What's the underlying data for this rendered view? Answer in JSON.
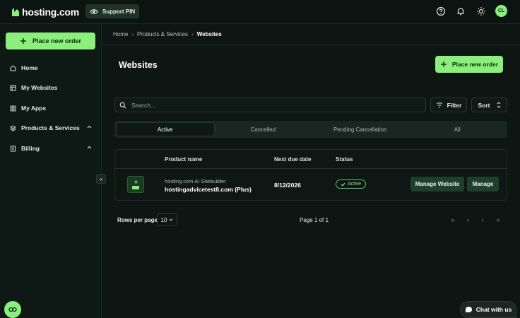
{
  "topbar": {
    "logo_text": "hosting.com",
    "support_pin_label": "Support PIN",
    "avatar_initials": "CL"
  },
  "sidebar": {
    "order_button_label": "Place new order",
    "items": [
      {
        "label": "Home",
        "icon": "home-icon"
      },
      {
        "label": "My Websites",
        "icon": "websites-icon"
      },
      {
        "label": "My Apps",
        "icon": "apps-icon"
      },
      {
        "label": "Products & Services",
        "icon": "products-icon",
        "expandable": true
      },
      {
        "label": "Billing",
        "icon": "billing-icon",
        "expandable": true
      }
    ],
    "collapse_glyph": "«"
  },
  "breadcrumb": [
    "Home",
    "Products & Services",
    "Websites"
  ],
  "main": {
    "title": "Websites",
    "order_button_label": "Place new order",
    "search_placeholder": "Search...",
    "filter_label": "Filter",
    "sort_label": "Sort",
    "tabs": [
      {
        "label": "Active",
        "active": true
      },
      {
        "label": "Cancelled",
        "active": false
      },
      {
        "label": "Pending Cancellation",
        "active": false
      },
      {
        "label": "All",
        "active": false
      }
    ],
    "table": {
      "headers": {
        "product": "Product name",
        "due": "Next due date",
        "status": "Status"
      },
      "rows": [
        {
          "product_type": "hosting.com AI Sitebuilder",
          "product_name": "hostingadvicetest8.com (Plus)",
          "next_due_date": "8/12/2026",
          "status": "Active",
          "manage_website_label": "Manage Website",
          "manage_label": "Manage"
        }
      ]
    },
    "pagination": {
      "rows_label": "Rows per page",
      "rows_value": "10",
      "page_info": "Page 1 of 1",
      "first": "«",
      "prev": "‹",
      "next": "›",
      "last": "»"
    }
  },
  "chat": {
    "label": "Chat with us"
  },
  "colors": {
    "accent": "#8af07b",
    "background": "#0d1612"
  }
}
